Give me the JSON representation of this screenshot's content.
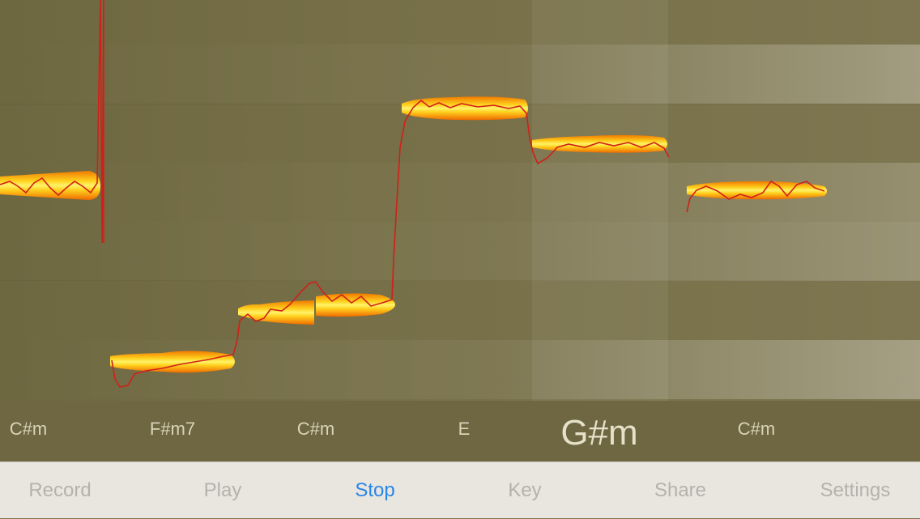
{
  "colors": {
    "background": "#7a7248",
    "lane_light": "#8a8360",
    "toolbar_bg": "#e9e6e0",
    "toolbar_text": "#b5b1ab",
    "toolbar_active": "#2a86e6",
    "pitch_line": "#d0201a",
    "note_outer": "#f29500",
    "note_inner": "#fff15a"
  },
  "chords": [
    {
      "label": "C#m",
      "active": false
    },
    {
      "label": "F#m7",
      "active": false
    },
    {
      "label": "C#m",
      "active": false
    },
    {
      "label": "E",
      "active": false
    },
    {
      "label": "G#m",
      "active": true
    },
    {
      "label": "C#m",
      "active": false
    }
  ],
  "toolbar": {
    "record_label": "Record",
    "play_label": "Play",
    "stop_label": "Stop",
    "key_label": "Key",
    "share_label": "Share",
    "settings_label": "Settings",
    "active": "stop"
  }
}
